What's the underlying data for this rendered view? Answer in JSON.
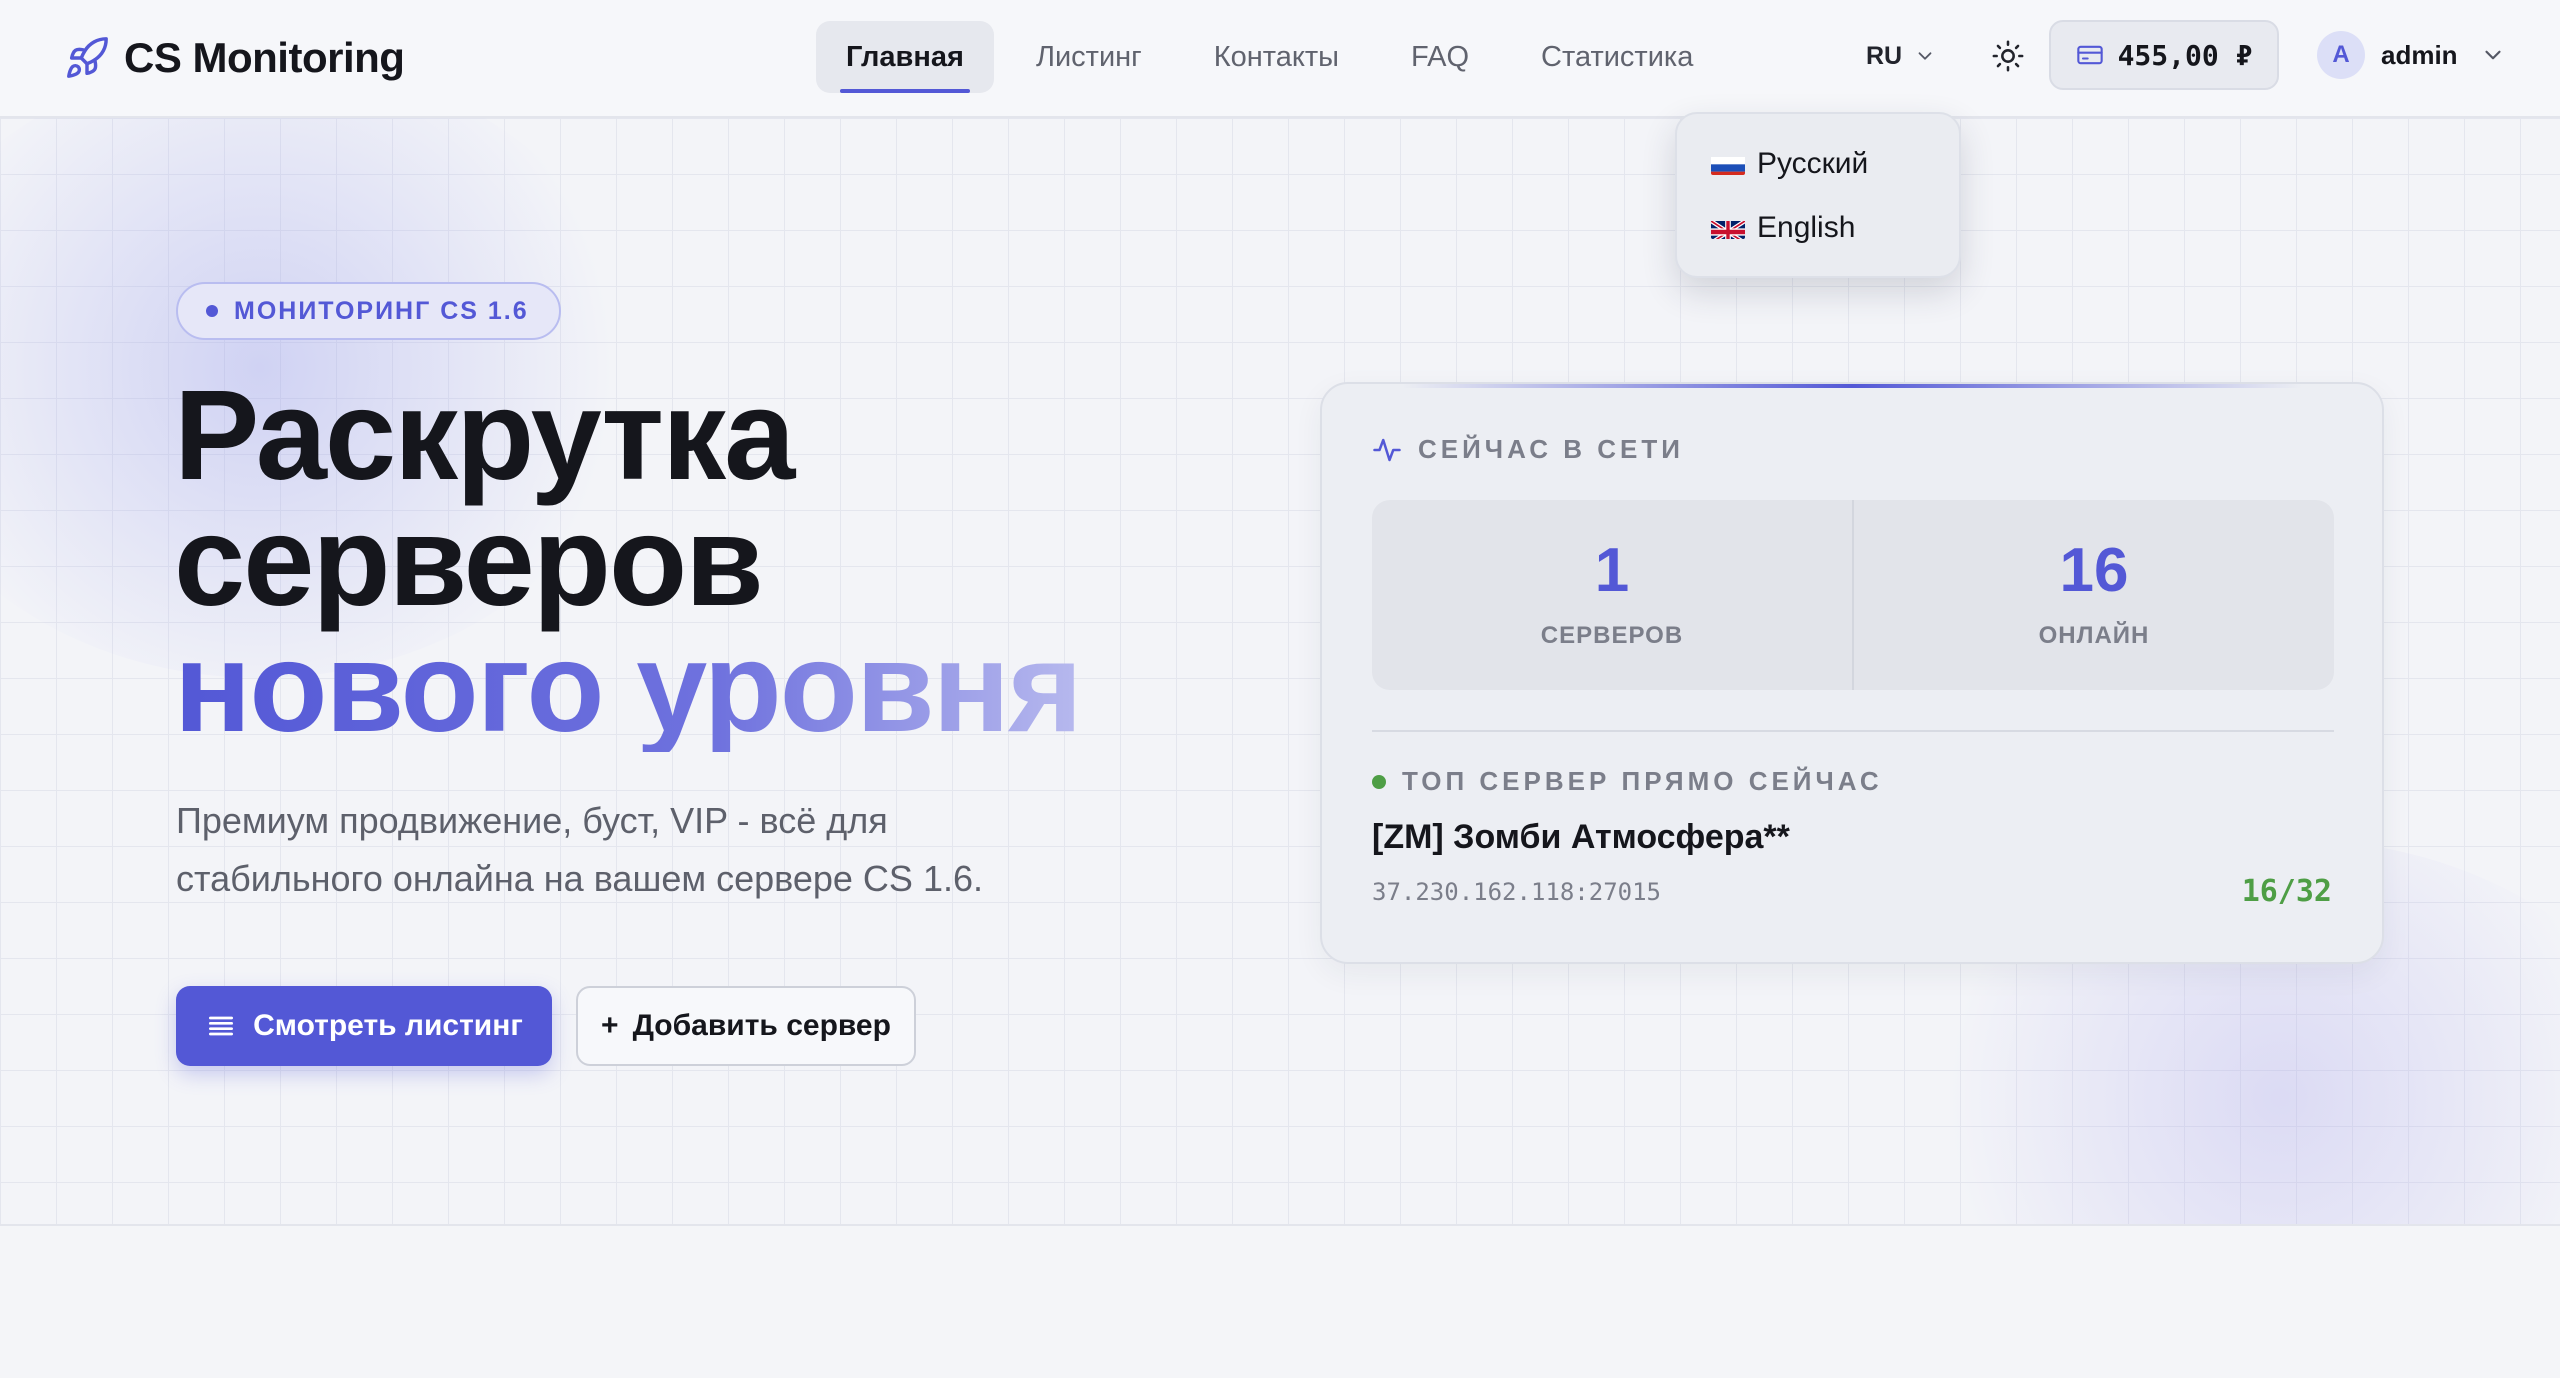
{
  "header": {
    "logo_text": "CS Monitoring",
    "nav": [
      {
        "label": "Главная",
        "active": true
      },
      {
        "label": "Листинг",
        "active": false
      },
      {
        "label": "Контакты",
        "active": false
      },
      {
        "label": "FAQ",
        "active": false
      },
      {
        "label": "Статистика",
        "active": false
      }
    ],
    "language": "RU",
    "balance": "455,00 ₽",
    "user": {
      "avatar_letter": "A",
      "name": "admin"
    }
  },
  "language_menu": {
    "items": [
      {
        "label": "Русский",
        "flag": "ru-flag"
      },
      {
        "label": "English",
        "flag": "gb-flag"
      }
    ]
  },
  "hero": {
    "badge": "МОНИТОРИНГ CS 1.6",
    "title_line1": "Раскрутка",
    "title_line2": "серверов",
    "title_line3": "нового уровня",
    "lead": "Премиум продвижение, буст, VIP - всё для стабильного онлайна на вашем сервере CS 1.6.",
    "primary_button": "Смотреть листинг",
    "secondary_button": "Добавить сервер",
    "secondary_button_prefix": "+"
  },
  "stats_card": {
    "label": "СЕЙЧАС В СЕТИ",
    "servers_value": "1",
    "servers_caption": "СЕРВЕРОВ",
    "online_value": "16",
    "online_caption": "ОНЛАЙН",
    "top_label": "ТОП СЕРВЕР ПРЯМО СЕЙЧАС",
    "top_server": {
      "name": "[ZM] Зомби Атмосфера**",
      "address": "37.230.162.118:27015",
      "players": "16/32"
    }
  },
  "colors": {
    "accent": "#5358d6",
    "online_green": "#4e9e45",
    "text_dark": "#15161c",
    "text_muted": "#7b7e8a"
  },
  "icons": {
    "logo": "rocket-icon",
    "language_chevron": "chevron-down-icon",
    "theme": "sun-icon",
    "balance": "credit-card-icon",
    "user_chevron": "chevron-down-icon",
    "primary_button": "list-icon",
    "card_label": "activity-icon"
  }
}
